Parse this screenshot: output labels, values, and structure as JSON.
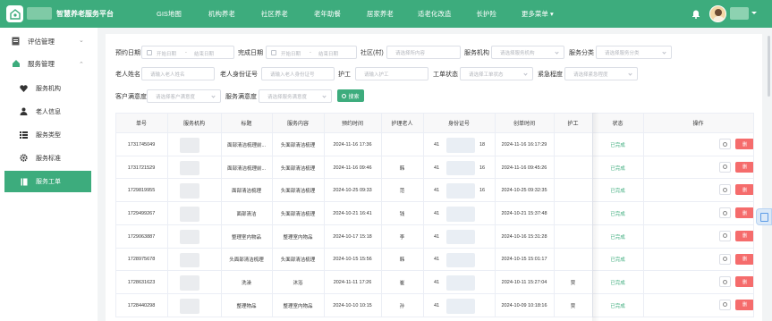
{
  "header": {
    "app_title": "智慧养老服务平台",
    "nav": [
      "GIS地图",
      "机构养老",
      "社区养老",
      "老年助餐",
      "居家养老",
      "适老化改造",
      "长护险",
      "更多菜单 ▾"
    ]
  },
  "sidebar": {
    "items": [
      {
        "label": "评估管理",
        "icon": "document-icon",
        "arrow": "⌄"
      },
      {
        "label": "服务管理",
        "icon": "home-icon",
        "arrow": "⌃"
      },
      {
        "label": "服务机构",
        "icon": "heart-icon"
      },
      {
        "label": "老人信息",
        "icon": "user-icon"
      },
      {
        "label": "服务类型",
        "icon": "list-icon"
      },
      {
        "label": "服务标准",
        "icon": "gear-icon"
      },
      {
        "label": "服务工单",
        "icon": "book-icon"
      }
    ]
  },
  "filters": {
    "appointment_date": {
      "label": "预约日期",
      "start": "开始日期",
      "end": "结束日期"
    },
    "finish_date": {
      "label": "完成日期",
      "start": "开始日期",
      "end": "结束日期"
    },
    "community": {
      "label": "社区(村)",
      "placeholder": "请选择所内容"
    },
    "org": {
      "label": "服务机构",
      "placeholder": "请选择服务机构"
    },
    "category": {
      "label": "服务分类",
      "placeholder": "请选择服务分类"
    },
    "elder_name": {
      "label": "老人姓名",
      "placeholder": "请输入老人姓名"
    },
    "elder_id": {
      "label": "老人身份证号",
      "placeholder": "请输入老人身份证号"
    },
    "nurse": {
      "label": "护工",
      "placeholder": "请输入护工"
    },
    "status": {
      "label": "工单状态",
      "placeholder": "请选择工单状态"
    },
    "urgency": {
      "label": "紧急程度",
      "placeholder": "请选择紧急程度"
    },
    "satisfaction": {
      "label": "客户满意度",
      "placeholder": "请选择客户满意度"
    },
    "service_satisfaction": {
      "label": "服务满意度",
      "placeholder": "请选择服务满意度"
    },
    "search_label": "搜索"
  },
  "table": {
    "headers": [
      "单号",
      "服务机构",
      "标题",
      "服务内容",
      "预约时间",
      "护理老人",
      "身份证号",
      "创单时间",
      "护工",
      "状态",
      "操作"
    ],
    "rows": [
      {
        "no": "1731745049",
        "title": "面部清洁梳理前...",
        "content": "头面部清洁梳理",
        "appt": "2024-11-16 17:36",
        "elder": "",
        "id_prefix": "41",
        "id_suffix": "18",
        "created": "2024-11-16 16:17:29",
        "nurse": "",
        "status": "已完成",
        "op_delete": "删"
      },
      {
        "no": "1731721529",
        "title": "面部清洁梳理前...",
        "content": "头面部清洁梳理",
        "appt": "2024-11-16 09:46",
        "elder": "韩",
        "id_prefix": "41",
        "id_suffix": "16",
        "created": "2024-11-16 09:45:26",
        "nurse": "",
        "status": "已完成",
        "op_delete": "删"
      },
      {
        "no": "1729819955",
        "title": "面部清洁梳理",
        "content": "头面部清洁梳理",
        "appt": "2024-10-25 09:33",
        "elder": "范",
        "id_prefix": "41",
        "id_suffix": "16",
        "created": "2024-10-25 09:32:35",
        "nurse": "",
        "status": "已完成",
        "op_delete": "删"
      },
      {
        "no": "1729499267",
        "title": "面部清洁",
        "content": "头面部清洁梳理",
        "appt": "2024-10-21 16:41",
        "elder": "钱",
        "id_prefix": "41",
        "id_suffix": "",
        "created": "2024-10-21 15:37:48",
        "nurse": "",
        "status": "已完成",
        "op_delete": "删"
      },
      {
        "no": "1729063887",
        "title": "整理室内物品",
        "content": "整理室内物品",
        "appt": "2024-10-17 15:18",
        "elder": "李",
        "id_prefix": "41",
        "id_suffix": "",
        "created": "2024-10-16 15:31:28",
        "nurse": "",
        "status": "已完成",
        "op_delete": "删"
      },
      {
        "no": "1728975678",
        "title": "头面部清洁梳理",
        "content": "头面部清洁梳理",
        "appt": "2024-10-15 15:56",
        "elder": "韩",
        "id_prefix": "41",
        "id_suffix": "",
        "created": "2024-10-15 15:01:17",
        "nurse": "",
        "status": "已完成",
        "op_delete": "删"
      },
      {
        "no": "1728631623",
        "title": "洗澡",
        "content": "沐浴",
        "appt": "2024-11-11 17:26",
        "elder": "崔",
        "id_prefix": "41",
        "id_suffix": "",
        "created": "2024-10-11 15:27:04",
        "nurse": "贾",
        "status": "已完成",
        "op_delete": "删"
      },
      {
        "no": "1728440298",
        "title": "整理物品",
        "content": "整理室内物品",
        "appt": "2024-10-10 10:15",
        "elder": "孙",
        "id_prefix": "41",
        "id_suffix": "",
        "created": "2024-10-09 10:18:16",
        "nurse": "贾",
        "status": "已完成",
        "op_delete": "删"
      }
    ]
  }
}
